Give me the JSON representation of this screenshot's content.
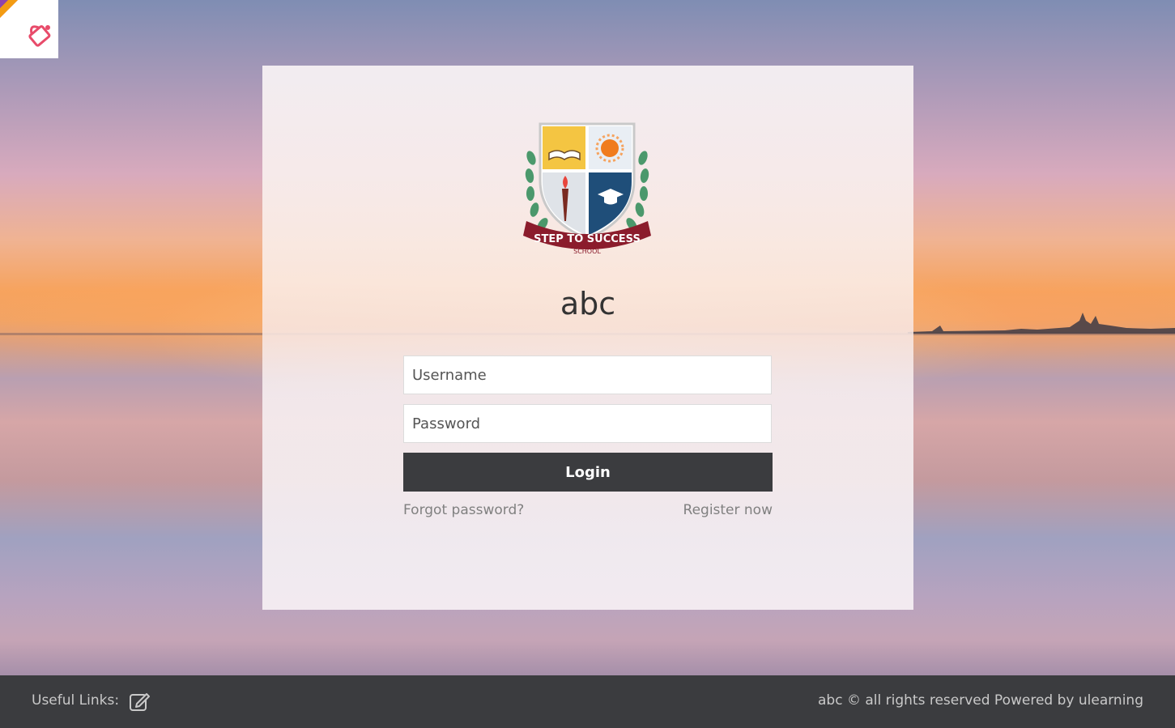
{
  "colors": {
    "card_background": "#f6eef0",
    "button_background": "#3b3c3f",
    "footer_background": "#3b3c3f",
    "link_color": "#808080"
  },
  "extension_badge": {
    "icon": "paint-bucket-icon"
  },
  "login": {
    "logo": {
      "icon": "school-crest-logo",
      "banner_text": "STEP TO SUCCESS",
      "sub_text": "SCHOOL"
    },
    "school_name": "abc",
    "username_placeholder": "Username",
    "password_placeholder": "Password",
    "login_button_label": "Login",
    "forgot_password_label": "Forgot password?",
    "register_label": "Register now"
  },
  "footer": {
    "useful_links_label": "Useful Links:",
    "edit_icon": "edit-icon",
    "copyright_text": "abc © all rights reserved  Powered by ulearning"
  }
}
